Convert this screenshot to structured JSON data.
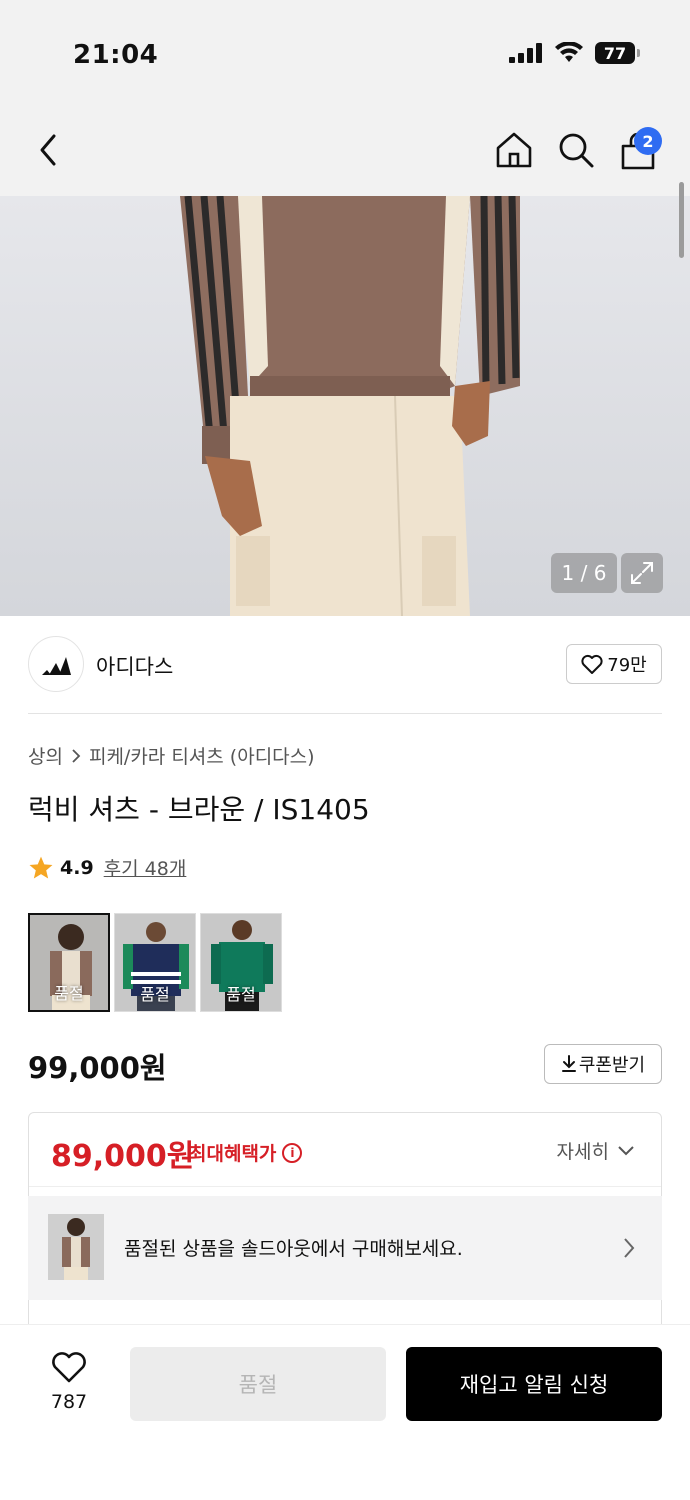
{
  "status_bar": {
    "time": "21:04",
    "battery": "77"
  },
  "nav": {
    "cart_count": "2"
  },
  "gallery": {
    "counter": "1 / 6"
  },
  "brand": {
    "name": "아디다스",
    "likes": "79만"
  },
  "product": {
    "breadcrumb": [
      "상의",
      "피케/카라 티셔츠 (아디다스)"
    ],
    "title": "럭비 셔츠 - 브라운 / IS1405",
    "rating": "4.9",
    "review_link": "후기 48개",
    "thumbnails": [
      {
        "label": "품절",
        "color": "#8a6a5c"
      },
      {
        "label": "품절",
        "color": "#1f2d5a"
      },
      {
        "label": "품절",
        "color": "#0f7a5b"
      }
    ],
    "price": "99,000원",
    "coupon_label": "쿠폰받기"
  },
  "benefit": {
    "price": "89,000원",
    "label": "최대혜택가",
    "detail": "자세히"
  },
  "soldout_banner": {
    "text": "품절된 상품을 솔드아웃에서 구매해보세요."
  },
  "bottom": {
    "wish_count": "787",
    "soldout_label": "품절",
    "restock_label": "재입고 알림 신청"
  },
  "colors": {
    "accent_red": "#d61f26",
    "badge_blue": "#2f6cf2"
  }
}
